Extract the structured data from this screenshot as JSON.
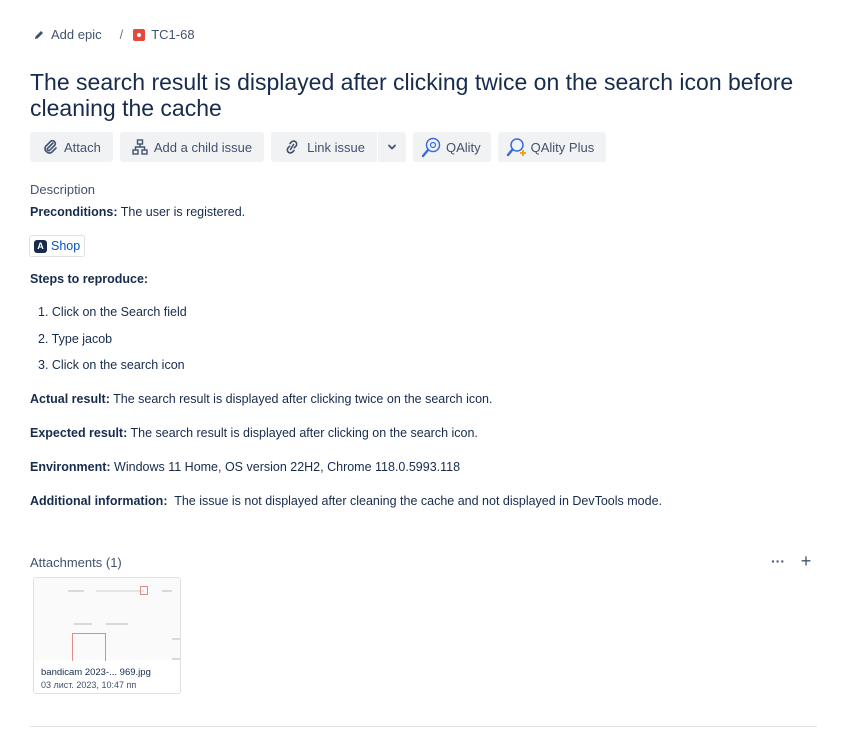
{
  "breadcrumb": {
    "add_epic": "Add epic",
    "separator": "/",
    "issue_key": "TC1-68"
  },
  "issue": {
    "title": "The search result is displayed after clicking twice on the search icon before cleaning the cache"
  },
  "toolbar": {
    "attach": "Attach",
    "add_child": "Add a child issue",
    "link_issue": "Link issue",
    "qality": "QAlity",
    "qality_plus": "QAlity Plus"
  },
  "description": {
    "label": "Description",
    "preconditions_label": "Preconditions:",
    "preconditions_text": " The user is registered.",
    "chip_label": "Shop",
    "steps_label": "Steps to reproduce:",
    "steps": [
      "1. Click on the Search field",
      "2. Type jacob",
      "3. Click on the search icon"
    ],
    "actual_label": "Actual result:",
    "actual_text": " The search result is displayed after clicking twice on the search icon.",
    "expected_label": "Expected result:",
    "expected_text": " The search result is displayed after clicking on the search icon.",
    "environment_label": "Environment:",
    "environment_text": " Windows 11 Home, OS version 22H2, Chrome 118.0.5993.118",
    "additional_label": "Additional information:",
    "additional_text": "  The issue is not displayed after cleaning the cache and not displayed in DevTools mode."
  },
  "attachments": {
    "header": "Attachments (1)",
    "more": "···",
    "add": "+",
    "items": [
      {
        "name": "bandicam 2023-... 969.jpg",
        "date": "03 лист. 2023, 10:47 пп"
      }
    ]
  },
  "colors": {
    "text": "#172b4d",
    "subtle": "#42526e",
    "link": "#0052cc",
    "bug": "#e5493a",
    "button_bg": "#f1f2f4"
  }
}
